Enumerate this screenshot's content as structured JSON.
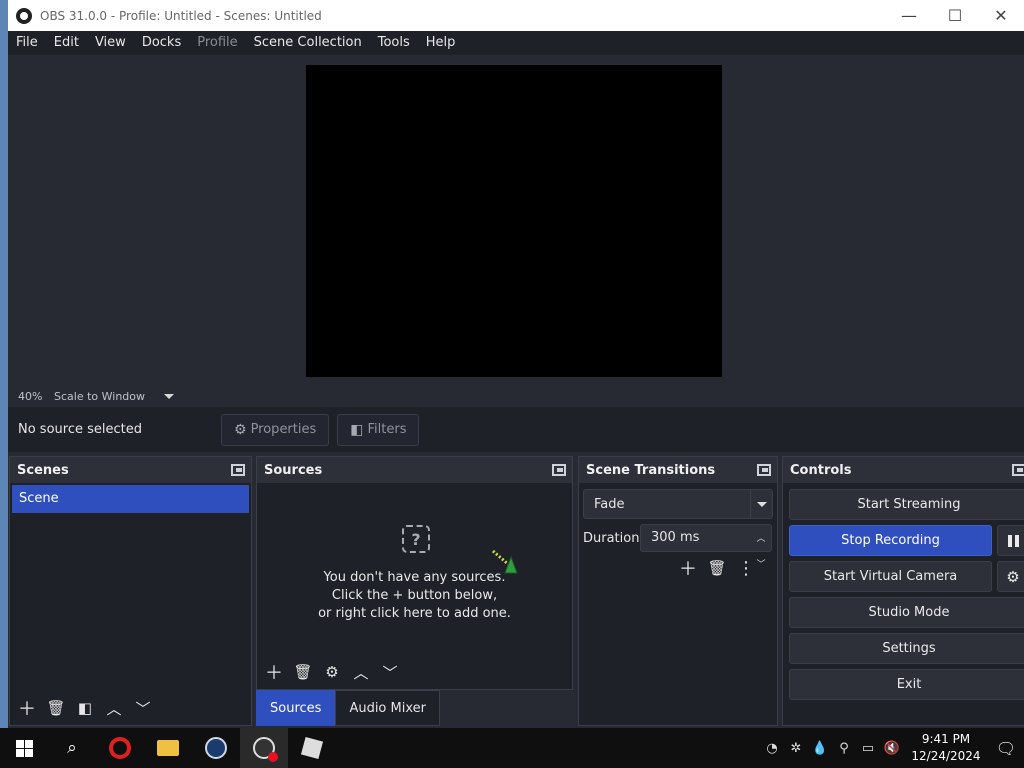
{
  "window": {
    "title": "OBS 31.0.0 - Profile: Untitled - Scenes: Untitled",
    "minimize": "—",
    "maximize": "☐",
    "close": "✕"
  },
  "menu": {
    "items": [
      {
        "label": "File",
        "enabled": true
      },
      {
        "label": "Edit",
        "enabled": true
      },
      {
        "label": "View",
        "enabled": true
      },
      {
        "label": "Docks",
        "enabled": true
      },
      {
        "label": "Profile",
        "enabled": false
      },
      {
        "label": "Scene Collection",
        "enabled": true
      },
      {
        "label": "Tools",
        "enabled": true
      },
      {
        "label": "Help",
        "enabled": true
      }
    ]
  },
  "zoombar": {
    "zoom": "40%",
    "scale_mode": "Scale to Window"
  },
  "context": {
    "no_source": "No source selected",
    "properties_label": "Properties",
    "filters_label": "Filters"
  },
  "scenes": {
    "title": "Scenes",
    "items": [
      "Scene"
    ]
  },
  "sources": {
    "title": "Sources",
    "empty_line1": "You don't have any sources.",
    "empty_line2": "Click the + button below,",
    "empty_line3": "or right click here to add one."
  },
  "tabs": {
    "sources": "Sources",
    "audio_mixer": "Audio Mixer"
  },
  "transitions": {
    "title": "Scene Transitions",
    "selected": "Fade",
    "duration_label": "Duration",
    "duration_value": "300 ms"
  },
  "controls": {
    "title": "Controls",
    "start_streaming": "Start Streaming",
    "stop_recording": "Stop Recording",
    "start_virtual_camera": "Start Virtual Camera",
    "studio_mode": "Studio Mode",
    "settings": "Settings",
    "exit": "Exit"
  },
  "taskbar": {
    "time": "9:41 PM",
    "date": "12/24/2024"
  },
  "colors": {
    "accent": "#2f4fbf",
    "background": "#272a33",
    "panel": "#1f2128"
  }
}
